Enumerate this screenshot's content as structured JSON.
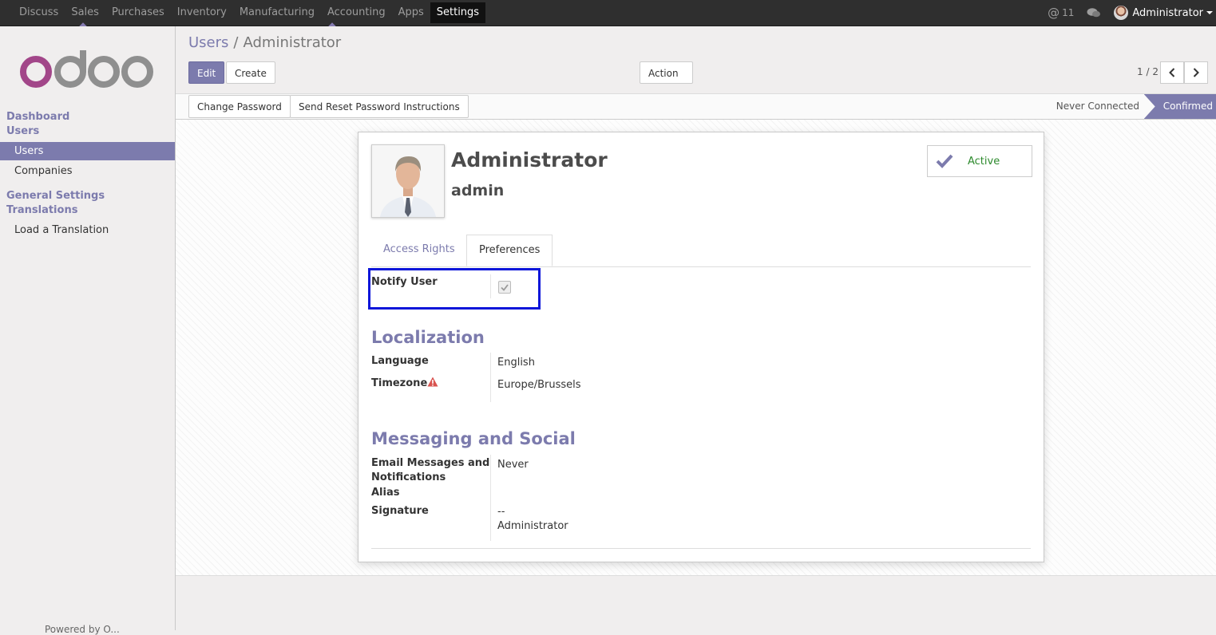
{
  "topbar": {
    "menu": [
      "Discuss",
      "Sales",
      "Purchases",
      "Inventory",
      "Manufacturing",
      "Accounting",
      "Apps",
      "Settings"
    ],
    "active_menu": "Settings",
    "mentions_count": "11",
    "user_name": "Administrator"
  },
  "sidebar": {
    "sections": {
      "dashboard": "Dashboard",
      "users": "Users",
      "general_settings": "General Settings",
      "translations": "Translations"
    },
    "items": {
      "users": "Users",
      "companies": "Companies",
      "load_translation": "Load a Translation"
    },
    "powered_by": "Powered by O..."
  },
  "breadcrumb": {
    "parent": "Users",
    "separator": "/",
    "current": "Administrator"
  },
  "toolbar": {
    "edit_label": "Edit",
    "create_label": "Create",
    "action_label": "Action",
    "pager": "1 / 2"
  },
  "statusbar": {
    "change_password": "Change Password",
    "send_reset": "Send Reset Password Instructions",
    "stage_never": "Never Connected",
    "stage_confirmed": "Confirmed"
  },
  "record": {
    "name": "Administrator",
    "login": "admin",
    "active_label": "Active",
    "tabs": [
      "Access Rights",
      "Preferences"
    ],
    "active_tab": "Preferences",
    "notify_user_label": "Notify User",
    "notify_user_checked": true,
    "localization_heading": "Localization",
    "language_label": "Language",
    "language_value": "English",
    "timezone_label": "Timezone",
    "timezone_value": "Europe/Brussels",
    "messaging_heading": "Messaging and Social",
    "email_label_1": "Email Messages and",
    "email_label_2": "Notifications",
    "email_value": "Never",
    "alias_label": "Alias",
    "signature_label": "Signature",
    "signature_line1": "--",
    "signature_line2": "Administrator"
  },
  "colors": {
    "brand": "#7c7bad",
    "navbar": "#2f2f2f",
    "highlight_box": "#0d16d9",
    "active_green": "#2d8a2d",
    "warning": "#d9534f"
  }
}
